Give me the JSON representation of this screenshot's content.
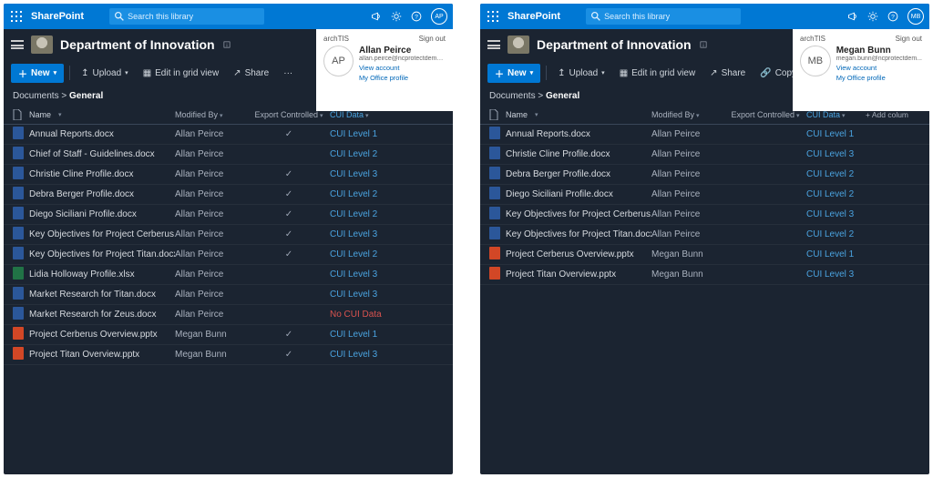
{
  "shared": {
    "app": "SharePoint",
    "search_placeholder": "Search this library",
    "site_title": "Department of Innovation",
    "public_label": "Publ",
    "org": "archTIS",
    "signout": "Sign out",
    "view_account": "View account",
    "office_profile": "My Office profile",
    "new_label": "New",
    "upload": "Upload",
    "grid": "Edit in grid view",
    "share": "Share",
    "copy_link": "Copy link",
    "breadcrumb_root": "Documents",
    "breadcrumb_current": "General",
    "cols": {
      "name": "Name",
      "modified_by": "Modified By",
      "export": "Export Controlled",
      "cui": "CUI Data",
      "add": "+ Add colum"
    }
  },
  "left": {
    "avatar_initials": "AP",
    "user_name": "Allan Peirce",
    "user_email": "allan.peirce@ncprotectdemo...",
    "rows": [
      {
        "icon": "docx",
        "name": "Annual Reports.docx",
        "mod": "Allan Peirce",
        "exp": true,
        "cui": "CUI Level 1"
      },
      {
        "icon": "docx",
        "name": "Chief of Staff - Guidelines.docx",
        "mod": "Allan Peirce",
        "exp": false,
        "cui": "CUI Level 2"
      },
      {
        "icon": "docx",
        "name": "Christie Cline Profile.docx",
        "mod": "Allan Peirce",
        "exp": true,
        "cui": "CUI Level 3"
      },
      {
        "icon": "docx",
        "name": "Debra Berger Profile.docx",
        "mod": "Allan Peirce",
        "exp": true,
        "cui": "CUI Level 2"
      },
      {
        "icon": "docx",
        "name": "Diego Siciliani Profile.docx",
        "mod": "Allan Peirce",
        "exp": true,
        "cui": "CUI Level 2"
      },
      {
        "icon": "docx",
        "name": "Key Objectives for Project Cerberus.docx",
        "mod": "Allan Peirce",
        "exp": true,
        "cui": "CUI Level 3"
      },
      {
        "icon": "docx",
        "name": "Key Objectives for Project Titan.docx",
        "mod": "Allan Peirce",
        "exp": true,
        "cui": "CUI Level 2"
      },
      {
        "icon": "xlsx",
        "name": "Lidia Holloway Profile.xlsx",
        "mod": "Allan Peirce",
        "exp": false,
        "cui": "CUI Level 3"
      },
      {
        "icon": "docx",
        "name": "Market Research for Titan.docx",
        "mod": "Allan Peirce",
        "exp": false,
        "cui": "CUI Level 3"
      },
      {
        "icon": "docx",
        "name": "Market Research for Zeus.docx",
        "mod": "Allan Peirce",
        "exp": false,
        "cui": "No CUI Data",
        "nocui": true
      },
      {
        "icon": "pptx",
        "name": "Project Cerberus Overview.pptx",
        "mod": "Megan Bunn",
        "exp": true,
        "cui": "CUI Level 1"
      },
      {
        "icon": "pptx",
        "name": "Project Titan Overview.pptx",
        "mod": "Megan Bunn",
        "exp": true,
        "cui": "CUI Level 3"
      }
    ]
  },
  "right": {
    "avatar_initials": "MB",
    "user_name": "Megan Bunn",
    "user_email": "megan.bunn@ncprotectdem...",
    "rows": [
      {
        "icon": "docx",
        "name": "Annual Reports.docx",
        "mod": "Allan Peirce",
        "exp": false,
        "cui": "CUI Level 1"
      },
      {
        "icon": "docx",
        "name": "Christie Cline Profile.docx",
        "mod": "Allan Peirce",
        "exp": false,
        "cui": "CUI Level 3"
      },
      {
        "icon": "docx",
        "name": "Debra Berger Profile.docx",
        "mod": "Allan Peirce",
        "exp": false,
        "cui": "CUI Level 2"
      },
      {
        "icon": "docx",
        "name": "Diego Siciliani Profile.docx",
        "mod": "Allan Peirce",
        "exp": false,
        "cui": "CUI Level 2"
      },
      {
        "icon": "docx",
        "name": "Key Objectives for Project Cerberus.docx",
        "mod": "Allan Peirce",
        "exp": false,
        "cui": "CUI Level 3"
      },
      {
        "icon": "docx",
        "name": "Key Objectives for Project Titan.docx",
        "mod": "Allan Peirce",
        "exp": false,
        "cui": "CUI Level 2"
      },
      {
        "icon": "pptx",
        "name": "Project Cerberus Overview.pptx",
        "mod": "Megan Bunn",
        "exp": false,
        "cui": "CUI Level 1"
      },
      {
        "icon": "pptx",
        "name": "Project Titan Overview.pptx",
        "mod": "Megan Bunn",
        "exp": false,
        "cui": "CUI Level 3"
      }
    ]
  }
}
